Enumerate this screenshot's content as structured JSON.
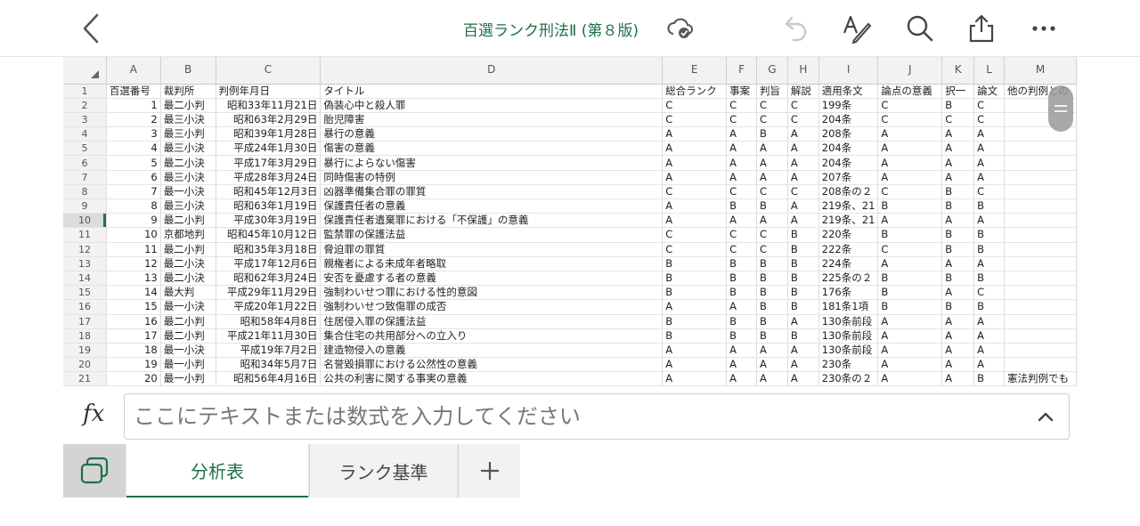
{
  "header": {
    "title": "百選ランク刑法Ⅱ (第８版)",
    "icons": [
      "back-chevron-icon",
      "cloud-synced-icon",
      "undo-icon",
      "draw-pen-icon",
      "search-icon",
      "share-icon",
      "more-icon"
    ]
  },
  "grid": {
    "columns": [
      "A",
      "B",
      "C",
      "D",
      "E",
      "F",
      "G",
      "H",
      "I",
      "J",
      "K",
      "L",
      "M"
    ],
    "active_row": "10",
    "header_row": {
      "row": "1",
      "cells": [
        "百選番号",
        "裁判所",
        "判例年月日",
        "タイトル",
        "総合ランク",
        "事案",
        "判旨",
        "解説",
        "適用条文",
        "論点の意義",
        "択一",
        "論文",
        "他の判例との"
      ]
    },
    "rows": [
      {
        "row": "2",
        "cells": [
          "1",
          "最二小判",
          "昭和33年11月21日",
          "偽装心中と殺人罪",
          "C",
          "C",
          "C",
          "C",
          "199条",
          "C",
          "B",
          "C",
          ""
        ]
      },
      {
        "row": "3",
        "cells": [
          "2",
          "最三小決",
          "昭和63年2月29日",
          "胎児障害",
          "C",
          "C",
          "C",
          "C",
          "204条",
          "C",
          "C",
          "C",
          ""
        ]
      },
      {
        "row": "4",
        "cells": [
          "3",
          "最三小判",
          "昭和39年1月28日",
          "暴行の意義",
          "A",
          "A",
          "B",
          "A",
          "208条",
          "A",
          "A",
          "A",
          ""
        ]
      },
      {
        "row": "5",
        "cells": [
          "4",
          "最三小決",
          "平成24年1月30日",
          "傷害の意義",
          "A",
          "A",
          "A",
          "A",
          "204条",
          "A",
          "A",
          "A",
          ""
        ]
      },
      {
        "row": "6",
        "cells": [
          "5",
          "最二小決",
          "平成17年3月29日",
          "暴行によらない傷害",
          "A",
          "A",
          "A",
          "A",
          "204条",
          "A",
          "A",
          "A",
          ""
        ]
      },
      {
        "row": "7",
        "cells": [
          "6",
          "最三小決",
          "平成28年3月24日",
          "同時傷害の特例",
          "A",
          "A",
          "A",
          "A",
          "207条",
          "A",
          "A",
          "A",
          ""
        ]
      },
      {
        "row": "8",
        "cells": [
          "7",
          "最一小決",
          "昭和45年12月3日",
          "凶器準備集合罪の罪質",
          "C",
          "C",
          "C",
          "C",
          "208条の２",
          "C",
          "B",
          "C",
          ""
        ]
      },
      {
        "row": "9",
        "cells": [
          "8",
          "最三小決",
          "昭和63年1月19日",
          "保護責任者の意義",
          "A",
          "B",
          "B",
          "A",
          "219条、21",
          "B",
          "B",
          "B",
          ""
        ]
      },
      {
        "row": "10",
        "cells": [
          "9",
          "最二小判",
          "平成30年3月19日",
          "保護責任者遺棄罪における「不保護」の意義",
          "A",
          "A",
          "A",
          "A",
          "219条、21",
          "A",
          "A",
          "A",
          ""
        ]
      },
      {
        "row": "11",
        "cells": [
          "10",
          "京都地判",
          "昭和45年10月12日",
          "監禁罪の保護法益",
          "C",
          "C",
          "C",
          "B",
          "220条",
          "B",
          "B",
          "B",
          ""
        ]
      },
      {
        "row": "12",
        "cells": [
          "11",
          "最二小判",
          "昭和35年3月18日",
          "脅迫罪の罪質",
          "C",
          "C",
          "C",
          "B",
          "222条",
          "C",
          "B",
          "B",
          ""
        ]
      },
      {
        "row": "13",
        "cells": [
          "12",
          "最二小決",
          "平成17年12月6日",
          "親権者による未成年者略取",
          "B",
          "B",
          "B",
          "B",
          "224条",
          "A",
          "A",
          "A",
          ""
        ]
      },
      {
        "row": "14",
        "cells": [
          "13",
          "最二小決",
          "昭和62年3月24日",
          "安否を憂慮する者の意義",
          "B",
          "B",
          "B",
          "B",
          "225条の２",
          "B",
          "B",
          "B",
          ""
        ]
      },
      {
        "row": "15",
        "cells": [
          "14",
          "最大判",
          "平成29年11月29日",
          "強制わいせつ罪における性的意図",
          "B",
          "B",
          "B",
          "B",
          "176条",
          "B",
          "A",
          "C",
          ""
        ]
      },
      {
        "row": "16",
        "cells": [
          "15",
          "最一小決",
          "平成20年1月22日",
          "強制わいせつ致傷罪の成否",
          "A",
          "A",
          "B",
          "B",
          "181条1項",
          "B",
          "B",
          "B",
          ""
        ]
      },
      {
        "row": "17",
        "cells": [
          "16",
          "最二小判",
          "昭和58年4月8日",
          "住居侵入罪の保護法益",
          "B",
          "B",
          "B",
          "A",
          "130条前段",
          "A",
          "A",
          "A",
          ""
        ]
      },
      {
        "row": "18",
        "cells": [
          "17",
          "最二小判",
          "平成21年11月30日",
          "集合住宅の共用部分への立入り",
          "B",
          "B",
          "B",
          "B",
          "130条前段",
          "A",
          "A",
          "A",
          ""
        ]
      },
      {
        "row": "19",
        "cells": [
          "18",
          "最一小決",
          "平成19年7月2日",
          "建造物侵入の意義",
          "A",
          "A",
          "A",
          "A",
          "130条前段",
          "A",
          "A",
          "A",
          ""
        ]
      },
      {
        "row": "20",
        "cells": [
          "19",
          "最一小判",
          "昭和34年5月7日",
          "名誉毀損罪における公然性の意義",
          "A",
          "A",
          "A",
          "A",
          "230条",
          "A",
          "A",
          "A",
          ""
        ]
      },
      {
        "row": "21",
        "cells": [
          "20",
          "最一小判",
          "昭和56年4月16日",
          "公共の利害に関する事実の意義",
          "A",
          "A",
          "A",
          "A",
          "230条の２",
          "A",
          "A",
          "B",
          "憲法判例でも"
        ]
      }
    ]
  },
  "formula_bar": {
    "fx_label": "fx",
    "placeholder": "ここにテキストまたは数式を入力してください",
    "value": ""
  },
  "sheet_tabs": [
    {
      "label": "分析表",
      "active": true
    },
    {
      "label": "ランク基準",
      "active": false
    }
  ],
  "add_tab_label": "+",
  "colors": {
    "accent": "#1e7145",
    "header_bg": "#f2f2f2",
    "grid_line": "#dcdcdc"
  }
}
